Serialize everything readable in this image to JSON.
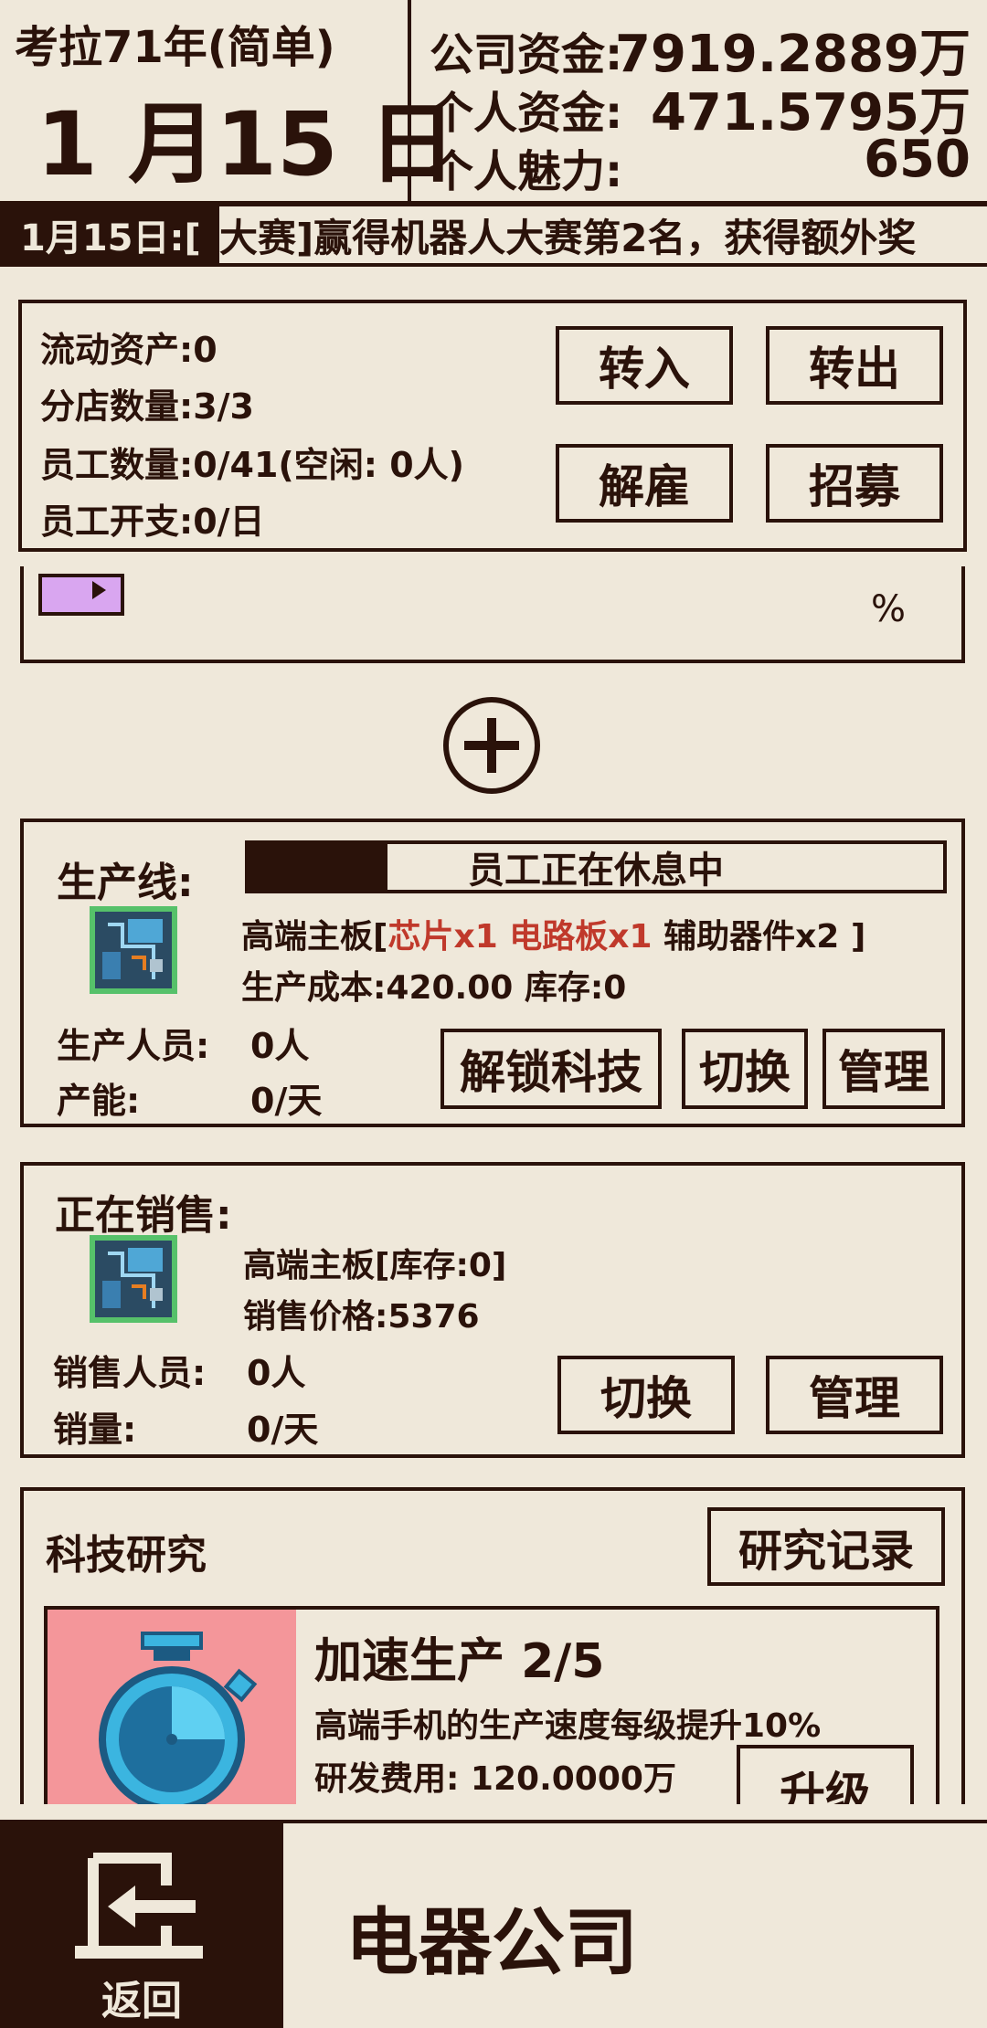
{
  "header": {
    "era": "考拉71年(简单)",
    "date": "1 月15 日",
    "company_funds_label": "公司资金:",
    "company_funds_value": "7919.2889万",
    "personal_funds_label": "个人资金:",
    "personal_funds_value": "471.5795万",
    "charm_label": "个人魅力:",
    "charm_value": "650"
  },
  "ticker": {
    "date": "1月15日:[",
    "text": "大赛]赢得机器人大赛第2名，获得额外奖"
  },
  "assets_panel": {
    "liquid_assets": "流动资产:0",
    "branch_count": "分店数量:3/3",
    "staff_count": "员工数量:0/41(空闲: 0人)",
    "staff_cost": "员工开支:0/日",
    "transfer_in": "转入",
    "transfer_out": "转出",
    "fire": "解雇",
    "recruit": "招募"
  },
  "partial_card": {
    "percent": "%"
  },
  "production": {
    "title": "生产线:",
    "status": "员工正在休息中",
    "progress": 0.2,
    "product_name": "高端主板[",
    "ingredient_red": "芯片x1 电路板x1",
    "ingredient_rest": " 辅助器件x2 ]",
    "cost": "生产成本:420.00 库存:0",
    "staff_label": "生产人员:",
    "staff_value": "0人",
    "capacity_label": "产能:",
    "capacity_value": "0/天",
    "unlock_tech": "解锁科技",
    "switch": "切换",
    "manage": "管理"
  },
  "sales": {
    "title": "正在销售:",
    "product": "高端主板[库存:0]",
    "price": "销售价格:5376",
    "staff_label": "销售人员:",
    "staff_value": "0人",
    "volume_label": "销量:",
    "volume_value": "0/天",
    "switch": "切换",
    "manage": "管理"
  },
  "research": {
    "title": "科技研究",
    "records": "研究记录",
    "item_title": "加速生产 2/5",
    "item_desc": "高端手机的生产速度每级提升10%",
    "item_cost": "研发费用: 120.0000万",
    "upgrade": "升级"
  },
  "nav": {
    "back": "返回",
    "title": "电器公司"
  },
  "colors": {
    "background": "#efe8da",
    "ink": "#2a120a",
    "accent_red": "#c0392b",
    "research_bg": "#f4969a",
    "stopwatch": "#3bb5e0"
  }
}
